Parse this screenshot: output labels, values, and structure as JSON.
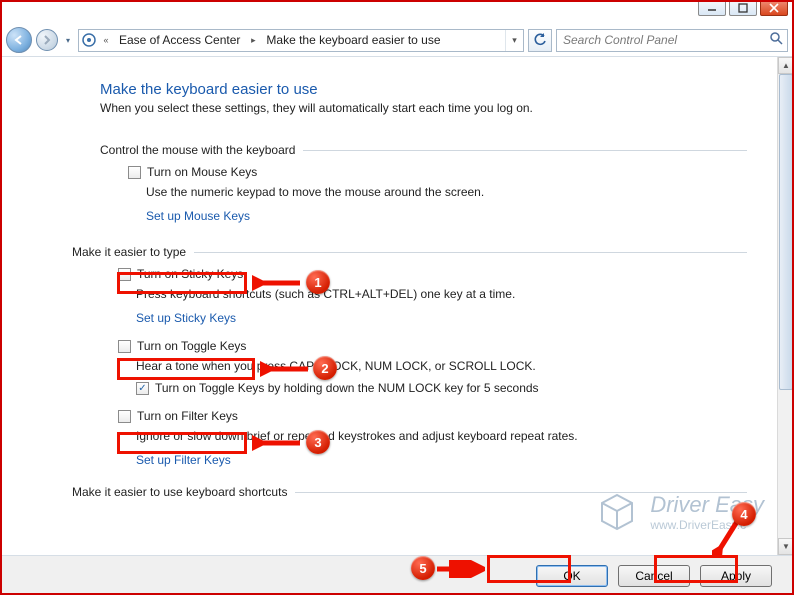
{
  "window": {
    "minimize": "–",
    "maximize": "▢",
    "close": "✕"
  },
  "breadcrumb": {
    "seg1": "Ease of Access Center",
    "seg2": "Make the keyboard easier to use"
  },
  "search": {
    "placeholder": "Search Control Panel"
  },
  "page": {
    "title": "Make the keyboard easier to use",
    "subtitle": "When you select these settings, they will automatically start each time you log on."
  },
  "sections": {
    "mouse": {
      "header": "Control the mouse with the keyboard",
      "chk_label": "Turn on Mouse Keys",
      "desc": "Use the numeric keypad to move the mouse around the screen.",
      "link": "Set up Mouse Keys"
    },
    "type": {
      "header": "Make it easier to type",
      "sticky": {
        "label": "Turn on Sticky Keys",
        "desc": "Press keyboard shortcuts (such as CTRL+ALT+DEL) one key at a time.",
        "link": "Set up Sticky Keys"
      },
      "toggle": {
        "label": "Turn on Toggle Keys",
        "desc": "Hear a tone when you press CAPS LOCK, NUM LOCK, or SCROLL LOCK.",
        "sub_label": "Turn on Toggle Keys by holding down the NUM LOCK key for 5 seconds"
      },
      "filter": {
        "label": "Turn on Filter Keys",
        "desc": "Ignore or slow down brief or repeated keystrokes and adjust keyboard repeat rates.",
        "link": "Set up Filter Keys"
      }
    },
    "shortcuts": {
      "header": "Make it easier to use keyboard shortcuts"
    }
  },
  "footer": {
    "ok": "OK",
    "cancel": "Cancel",
    "apply": "Apply"
  },
  "annotations": {
    "b1": "1",
    "b2": "2",
    "b3": "3",
    "b4": "4",
    "b5": "5"
  },
  "watermark": {
    "line1": "Driver Easy",
    "line2": "www.DriverEasy.c"
  }
}
